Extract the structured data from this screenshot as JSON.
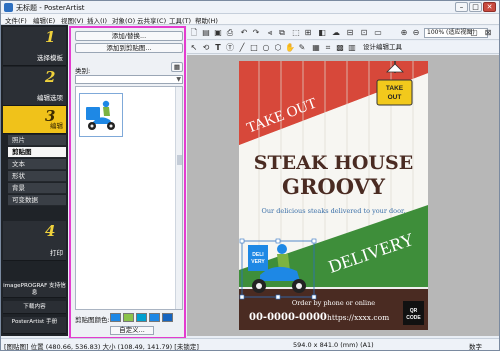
{
  "window": {
    "title": "无标题 - PosterArtist"
  },
  "menu": [
    "文件(F)",
    "编辑(E)",
    "视图(V)",
    "插入(I)",
    "对象(O)",
    "云共享(C)",
    "工具(T)",
    "帮助(H)"
  ],
  "steps": [
    {
      "num": "1",
      "label": "选择模板"
    },
    {
      "num": "2",
      "label": "编辑选项"
    },
    {
      "num": "3",
      "label": "编辑"
    },
    {
      "num": "4",
      "label": "打印"
    }
  ],
  "edit_subitems": [
    "照片",
    "剪贴图",
    "文本",
    "形状",
    "背景",
    "可变数据"
  ],
  "side_links": [
    "imagePROGRAF 支持信息",
    "下载内容",
    "PosterArtist 手册"
  ],
  "panel": {
    "add_replace": "添加/替换...",
    "add_clipart": "添加到剪贴图...",
    "category_label": "类别:",
    "clip_color_label": "剪贴图颜色:",
    "custom_button": "自定义...",
    "swatches": [
      "#1e88e5",
      "#8bc34a",
      "#00a0d0",
      "#1e88e5",
      "#1565c0"
    ]
  },
  "toolbar": {
    "zoom_value": "100% (适应视图)",
    "design_tool": "设计编辑工具"
  },
  "poster": {
    "take_out": "TAKE OUT",
    "badge": "TAKE OUT",
    "title_line1": "STEAK HOUSE",
    "title_line2": "GROOVY",
    "subtitle": "Our delicious steaks delivered to your door.",
    "delivery": "DELIVERY",
    "deli_box": "DELI VERY",
    "order_text": "Order by phone or online",
    "phone": "00-0000-0000",
    "url": "https://xxxx.com",
    "qr_line1": "QR",
    "qr_line2": "CODE"
  },
  "status": {
    "coords": "[图贴图] 位置 (480.66, 536.83) 大小 (108.49, 141.79) [未锁定]",
    "page_size": "594.0 x 841.0 (mm) (A1)",
    "mode": "数字"
  }
}
